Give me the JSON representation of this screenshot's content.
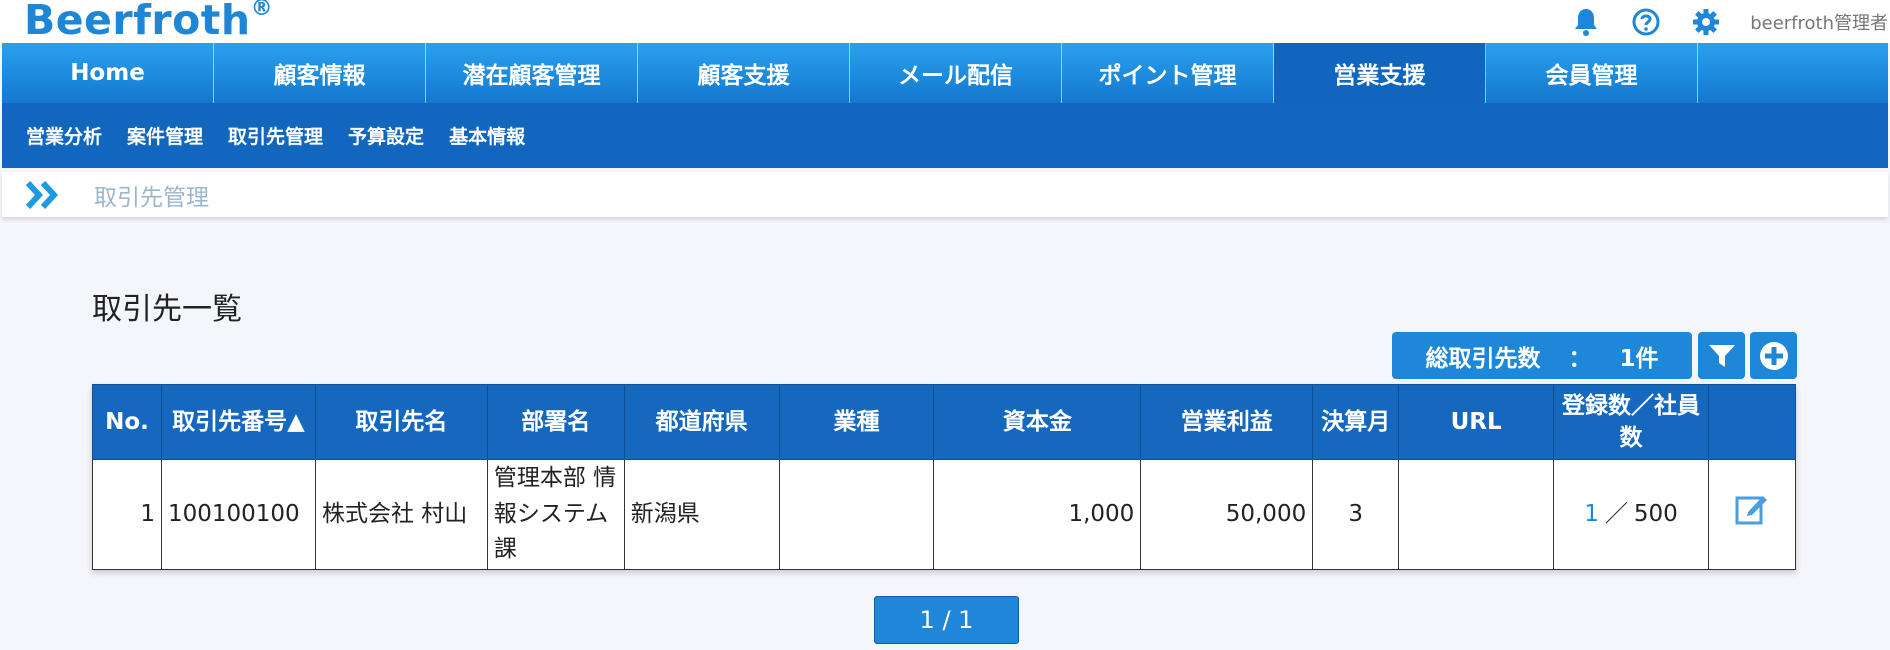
{
  "app": {
    "logo_text": "Beerfroth",
    "logo_mark": "®",
    "user_name": "beerfroth管理者",
    "icons": [
      "bell-icon",
      "help-icon",
      "gear-icon"
    ],
    "accent_color": "#1e87d8"
  },
  "main_nav": [
    {
      "label": "Home",
      "active": false
    },
    {
      "label": "顧客情報",
      "active": false
    },
    {
      "label": "潜在顧客管理",
      "active": false
    },
    {
      "label": "顧客支援",
      "active": false
    },
    {
      "label": "メール配信",
      "active": false
    },
    {
      "label": "ポイント管理",
      "active": false
    },
    {
      "label": "営業支援",
      "active": true
    },
    {
      "label": "会員管理",
      "active": false
    }
  ],
  "sub_nav": [
    "営業分析",
    "案件管理",
    "取引先管理",
    "予算設定",
    "基本情報"
  ],
  "breadcrumb": {
    "icon": "double-chevron-right-icon",
    "label": "取引先管理"
  },
  "page": {
    "title": "取引先一覧",
    "total_label": "総取引先数",
    "total_sep": "：",
    "total_count": "1件",
    "filter_icon": "filter-icon",
    "add_icon": "plus-circle-icon"
  },
  "table": {
    "headers": [
      "No.",
      "取引先番号▲",
      "取引先名",
      "部署名",
      "都道府県",
      "業種",
      "資本金",
      "営業利益",
      "決算月",
      "URL",
      "登録数／社員数",
      ""
    ],
    "rows": [
      {
        "no": "1",
        "code": "100100100",
        "name": "株式会社 村山",
        "dept": "管理本部 情報システム課",
        "pref": "新潟県",
        "industry": "",
        "capital": "1,000",
        "profit": "50,000",
        "month": "3",
        "url": "",
        "reg_count": "1",
        "reg_sep": "／",
        "employees": "500",
        "edit_icon": "edit-icon"
      }
    ]
  },
  "pager": {
    "label": "1 / 1"
  }
}
